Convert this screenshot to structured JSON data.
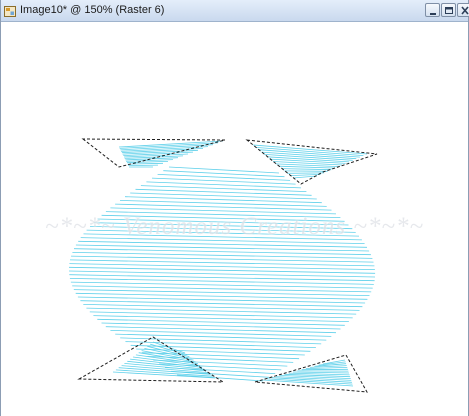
{
  "window": {
    "title": "Image10* @ 150% (Raster 6)",
    "app_icon": "psp-document-icon",
    "controls": [
      "minimize-icon",
      "maximize-icon",
      "close-icon"
    ]
  },
  "canvas": {
    "background": "#ffffff",
    "stroke_color": "#5fd0ea",
    "selection_style": "marching-ants-dashed",
    "watermark": "~*~*~ Venomous Creations ~*~*~"
  }
}
